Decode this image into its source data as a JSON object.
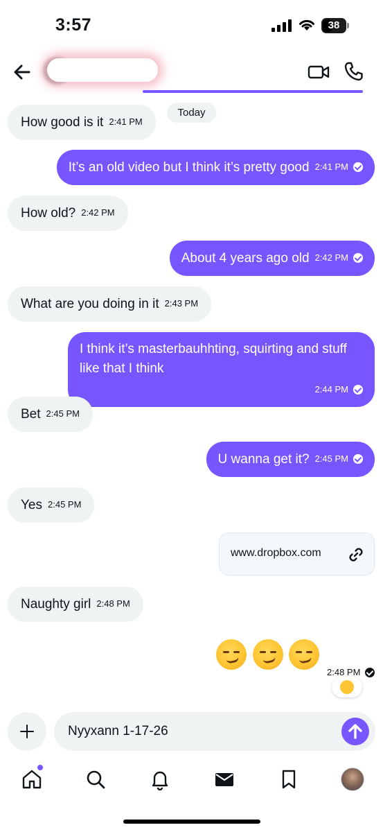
{
  "status_bar": {
    "time": "3:57",
    "battery": "38"
  },
  "header": {
    "contact_name": ""
  },
  "chat": {
    "day_label": "Today",
    "messages": [
      {
        "side": "in",
        "text": "How good is it",
        "time": "2:41 PM"
      },
      {
        "side": "out",
        "text": "It’s an old video but I think it’s pretty good",
        "time": "2:41 PM"
      },
      {
        "side": "in",
        "text": "How old?",
        "time": "2:42 PM"
      },
      {
        "side": "out",
        "text": "About 4 years ago old",
        "time": "2:42 PM"
      },
      {
        "side": "in",
        "text": "What are you doing in it",
        "time": "2:43 PM"
      },
      {
        "side": "out",
        "text": "I think it’s masterbauhhting, squirting and stuff like that I think",
        "time": "2:44 PM"
      },
      {
        "side": "in",
        "text": "Bet",
        "time": "2:45 PM"
      },
      {
        "side": "out",
        "text": "U wanna get it?",
        "time": "2:45 PM"
      },
      {
        "side": "in",
        "text": "Yes",
        "time": "2:45 PM"
      },
      {
        "side": "in",
        "text": "Naughty girl",
        "time": "2:48 PM"
      }
    ],
    "link_card": {
      "text": "www.dropbox.com"
    },
    "emoji_message": {
      "emojis": [
        "smirking-face",
        "smirking-face",
        "smirking-face"
      ],
      "time": "2:48 PM",
      "reaction": "winking-face"
    }
  },
  "composer": {
    "value": "Nyyxann 1-17-26"
  },
  "bottom_nav": {
    "items": [
      "home",
      "search",
      "notifications",
      "messages",
      "bookmarks",
      "profile"
    ],
    "active": "messages"
  },
  "colors": {
    "accent": "#7856ff",
    "incoming_bubble": "#eff3f4",
    "text": "#0f1419"
  }
}
